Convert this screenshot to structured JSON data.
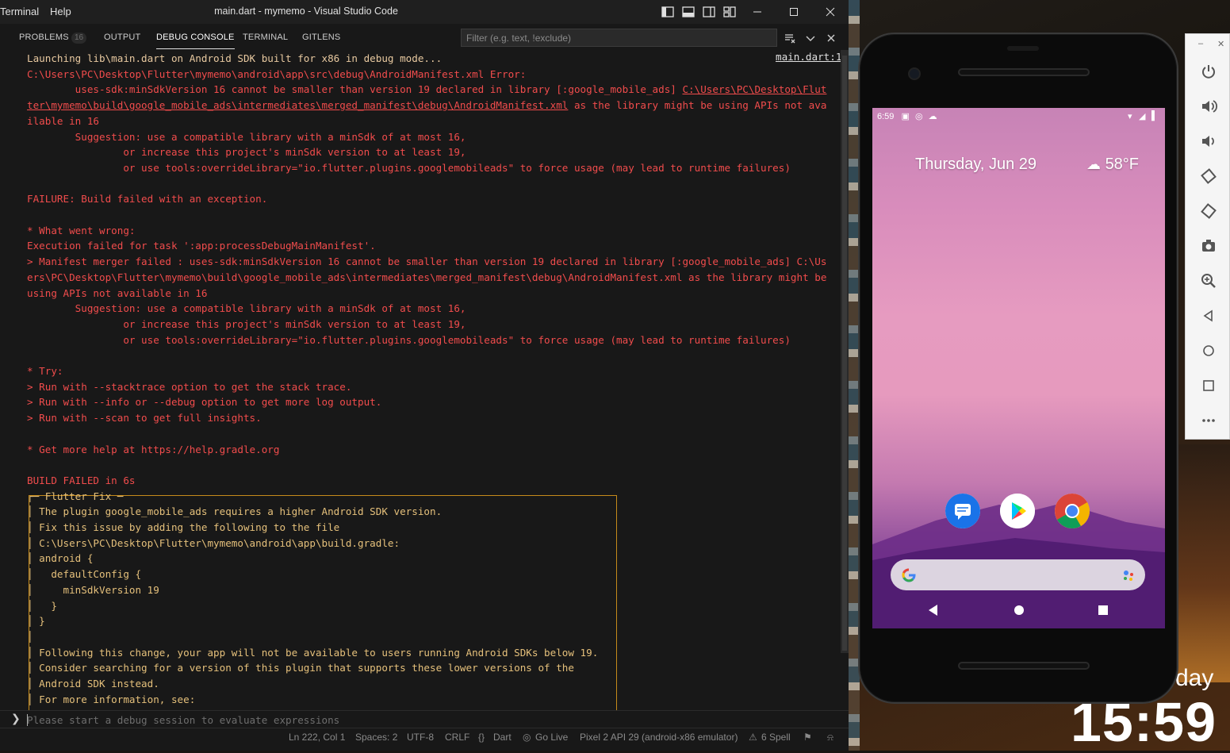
{
  "window": {
    "title": "main.dart - mymemo - Visual Studio Code",
    "menu": [
      "Terminal",
      "Help"
    ]
  },
  "panel": {
    "tabs": [
      {
        "label": "PROBLEMS",
        "badge": "16"
      },
      {
        "label": "OUTPUT"
      },
      {
        "label": "DEBUG CONSOLE",
        "active": true
      },
      {
        "label": "TERMINAL"
      },
      {
        "label": "GITLENS"
      }
    ],
    "filter_placeholder": "Filter (e.g. text, !exclude)"
  },
  "console": {
    "source_link": "main.dart:1",
    "lines": [
      {
        "text": "Launching lib\\main.dart on Android SDK built for x86 in debug mode...",
        "style": "info"
      },
      {
        "text": "C:\\Users\\PC\\Desktop\\Flutter\\mymemo\\android\\app\\src\\debug\\AndroidManifest.xml Error:",
        "style": "err"
      },
      {
        "text": "        uses-sdk:minSdkVersion 16 cannot be smaller than version 19 declared in library [:google_mobile_ads] ",
        "style": "err",
        "link": "C:\\Users\\PC\\Desktop\\Flut"
      },
      {
        "text": "",
        "style": "err",
        "link": "ter\\mymemo\\build\\google_mobile_ads\\intermediates\\merged_manifest\\debug\\AndroidManifest.xml",
        "after": " as the library might be using APIs not ava"
      },
      {
        "text": "ilable in 16",
        "style": "err"
      },
      {
        "text": "        Suggestion: use a compatible library with a minSdk of at most 16,",
        "style": "err"
      },
      {
        "text": "                or increase this project's minSdk version to at least 19,",
        "style": "err"
      },
      {
        "text": "                or use tools:overrideLibrary=\"io.flutter.plugins.googlemobileads\" to force usage (may lead to runtime failures)",
        "style": "err"
      },
      {
        "text": "",
        "style": "err"
      },
      {
        "text": "FAILURE: Build failed with an exception.",
        "style": "err"
      },
      {
        "text": "",
        "style": "err"
      },
      {
        "text": "* What went wrong:",
        "style": "err"
      },
      {
        "text": "Execution failed for task ':app:processDebugMainManifest'.",
        "style": "err"
      },
      {
        "text": "> Manifest merger failed : uses-sdk:minSdkVersion 16 cannot be smaller than version 19 declared in library [:google_mobile_ads] C:\\Us",
        "style": "err"
      },
      {
        "text": "ers\\PC\\Desktop\\Flutter\\mymemo\\build\\google_mobile_ads\\intermediates\\merged_manifest\\debug\\AndroidManifest.xml as the library might be",
        "style": "err"
      },
      {
        "text": "using APIs not available in 16",
        "style": "err"
      },
      {
        "text": "        Suggestion: use a compatible library with a minSdk of at most 16,",
        "style": "err"
      },
      {
        "text": "                or increase this project's minSdk version to at least 19,",
        "style": "err"
      },
      {
        "text": "                or use tools:overrideLibrary=\"io.flutter.plugins.googlemobileads\" to force usage (may lead to runtime failures)",
        "style": "err"
      },
      {
        "text": "",
        "style": "err"
      },
      {
        "text": "* Try:",
        "style": "err"
      },
      {
        "text": "> Run with --stacktrace option to get the stack trace.",
        "style": "err"
      },
      {
        "text": "> Run with --info or --debug option to get more log output.",
        "style": "err"
      },
      {
        "text": "> Run with --scan to get full insights.",
        "style": "err"
      },
      {
        "text": "",
        "style": "err"
      },
      {
        "text": "* Get more help at https://help.gradle.org",
        "style": "err"
      },
      {
        "text": "",
        "style": "err"
      },
      {
        "text": "BUILD FAILED in 6s",
        "style": "err"
      },
      {
        "text": "┌─ Flutter Fix ─",
        "style": "yel"
      },
      {
        "text": "│ The plugin google_mobile_ads requires a higher Android SDK version.",
        "style": "yel"
      },
      {
        "text": "│ Fix this issue by adding the following to the file",
        "style": "yel"
      },
      {
        "text": "│ C:\\Users\\PC\\Desktop\\Flutter\\mymemo\\android\\app\\build.gradle:",
        "style": "yel"
      },
      {
        "text": "│ android {",
        "style": "yel"
      },
      {
        "text": "│   defaultConfig {",
        "style": "yel"
      },
      {
        "text": "│     minSdkVersion 19",
        "style": "yel"
      },
      {
        "text": "│   }",
        "style": "yel"
      },
      {
        "text": "│ }",
        "style": "yel"
      },
      {
        "text": "│",
        "style": "yel"
      },
      {
        "text": "│ Following this change, your app will not be available to users running Android SDKs below 19.",
        "style": "yel"
      },
      {
        "text": "│ Consider searching for a version of this plugin that supports these lower versions of the",
        "style": "yel"
      },
      {
        "text": "│ Android SDK instead.",
        "style": "yel"
      },
      {
        "text": "│ For more information, see:",
        "style": "yel"
      }
    ]
  },
  "repl": {
    "placeholder": "Please start a debug session to evaluate expressions"
  },
  "statusbar": {
    "position": "Ln 222, Col 1",
    "spaces": "Spaces: 2",
    "encoding": "UTF-8",
    "eol": "CRLF",
    "language": "Dart",
    "go_live": "Go Live",
    "device": "Pixel 2 API 29 (android-x86 emulator)",
    "spell": "6 Spell"
  },
  "phone": {
    "time": "6:59",
    "date": "Thursday, Jun 29",
    "weather": "58°F"
  },
  "desktop": {
    "day_partial": "day",
    "clock": "15:59"
  },
  "icons": {
    "emulator_toolbar": [
      "power-icon",
      "volume-up-icon",
      "volume-down-icon",
      "rotate-left-icon",
      "rotate-right-icon",
      "camera-icon",
      "zoom-icon",
      "back-icon",
      "home-icon",
      "overview-icon",
      "more-icon"
    ]
  }
}
